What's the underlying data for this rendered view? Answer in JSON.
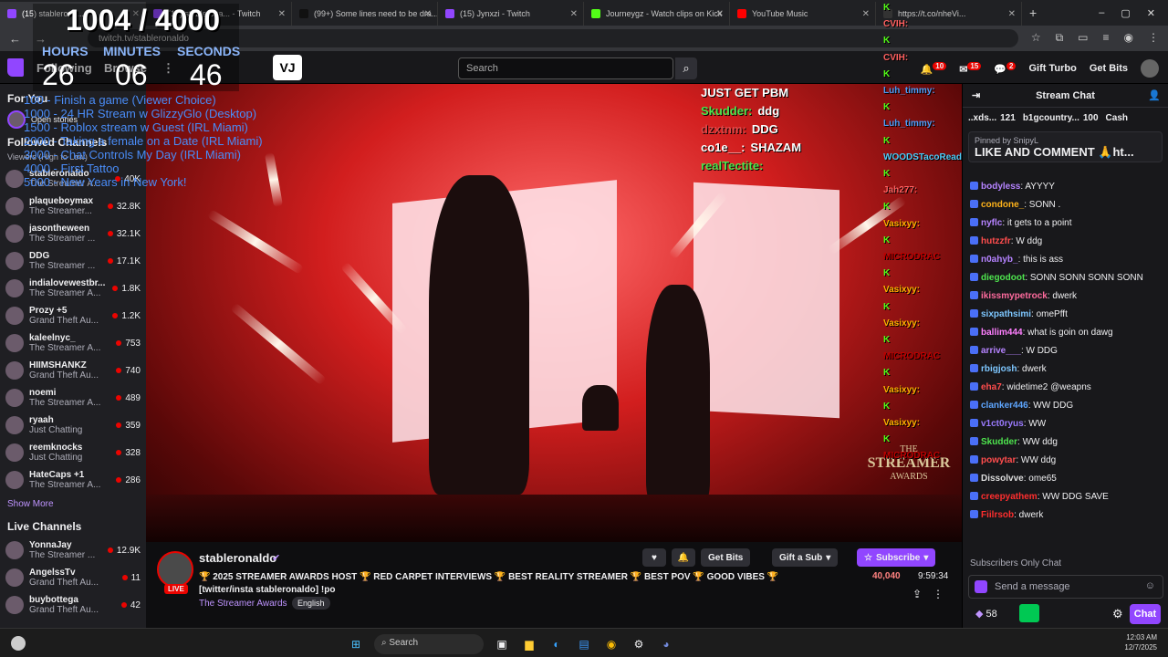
{
  "browser": {
    "tabs": [
      {
        "label": "(15) stablerona...",
        "color": "#9146ff",
        "active": true
      },
      {
        "label": "(15) stablerona... - Twitch",
        "color": "#9146ff"
      },
      {
        "label": "(99+) Some lines need to be dra...",
        "color": "#111111"
      },
      {
        "label": "(15) Jynxzi - Twitch",
        "color": "#9146ff"
      },
      {
        "label": "Journeygz - Watch clips on Kick",
        "color": "#53fc18"
      },
      {
        "label": "YouTube Music",
        "color": "#ff0000"
      },
      {
        "label": "https://t.co/nheVi...",
        "color": "#333333"
      }
    ],
    "url": "twitch.tv/stableronaldo",
    "win_controls": [
      "–",
      "▢",
      "✕"
    ]
  },
  "twitch_nav": {
    "following": "Following",
    "browse": "Browse",
    "search_placeholder": "Search",
    "gift_turbo": "Gift Turbo",
    "get_bits": "Get Bits",
    "notif_count": "10",
    "inbox_count": "15",
    "whisper_count": "2"
  },
  "overlay": {
    "counter": "1004 / 4000",
    "labels": {
      "hours": "HOURS",
      "minutes": "MINUTES",
      "seconds": "SECONDS"
    },
    "hours": "26",
    "minutes": "06",
    "seconds": "46",
    "goals": [
      "100 - Finish a game (Viewer Choice)",
      "1000 - 24 HR Stream w GlizzyGlo (Desktop)",
      "1500 - Roblox stream w Guest (IRL Miami)",
      "2000 - Taking a female on a Date (IRL Miami)",
      "3000 - Chat Controls My Day (IRL Miami)",
      "4000 - First Tattoo",
      "5000 - New Years in New York!"
    ],
    "pbm_title": "JUST GET PBM",
    "pbm": [
      {
        "user": "Skudder:",
        "msg": "ddg",
        "color": "#4ee44e"
      },
      {
        "user": "dzxtnm:",
        "msg": "DDG",
        "color": "#e04848"
      },
      {
        "user": "co1e__:",
        "msg": "SHAZAM",
        "color": "#ffffff"
      },
      {
        "user": "realTectite:",
        "msg": "",
        "color": "#4ee44e"
      }
    ],
    "kick_chat": [
      {
        "user": "CVIH:",
        "color": "#ff6060"
      },
      {
        "user": "CVIH:",
        "color": "#ff6060"
      },
      {
        "user": "Luh_timmy:",
        "color": "#4e9cf7"
      },
      {
        "user": "Luh_timmy:",
        "color": "#4e9cf7"
      },
      {
        "user": "WOODSTacoRead",
        "color": "#4ecaf7"
      },
      {
        "user": "Jah277:",
        "color": "#ff6060"
      },
      {
        "user": "Vasixyy:",
        "color": "#ffb000"
      },
      {
        "user": "MICRODRAC",
        "color": "#c00000"
      },
      {
        "user": "Vasixyy:",
        "color": "#ffb000"
      },
      {
        "user": "Vasixyy:",
        "color": "#ffb000"
      },
      {
        "user": "MICRODRAC",
        "color": "#c00000"
      },
      {
        "user": "Vasixyy:",
        "color": "#ffb000"
      },
      {
        "user": "Vasixyy:",
        "color": "#ffb000"
      },
      {
        "user": "MICRODRAC",
        "color": "#c00000"
      }
    ],
    "award_line1": "THE",
    "award_line2": "STREAMER",
    "award_line3": "AWARDS"
  },
  "sidebar": {
    "for_you": "For You",
    "open_stories": "Open stories",
    "followed": "Followed Channels",
    "sort": "Viewers (High to Low)",
    "channels": [
      {
        "name": "stableronaldo",
        "game": "The Streamer A...",
        "viewers": "40K"
      },
      {
        "name": "plaqueboymax",
        "game": "The Streamer...",
        "viewers": "32.8K"
      },
      {
        "name": "jasontheween",
        "game": "The Streamer ...",
        "viewers": "32.1K"
      },
      {
        "name": "DDG",
        "game": "The Streamer ...",
        "viewers": "17.1K"
      },
      {
        "name": "indialovewestbr...",
        "game": "The Streamer A...",
        "viewers": "1.8K"
      },
      {
        "name": "Prozy +5",
        "game": "Grand Theft Au...",
        "viewers": "1.2K"
      },
      {
        "name": "kaleelnyc_",
        "game": "The Streamer A...",
        "viewers": "753"
      },
      {
        "name": "HIIMSHANKZ",
        "game": "Grand Theft Au...",
        "viewers": "740"
      },
      {
        "name": "noemi",
        "game": "The Streamer A...",
        "viewers": "489"
      },
      {
        "name": "ryaah",
        "game": "Just Chatting",
        "viewers": "359"
      },
      {
        "name": "reemknocks",
        "game": "Just Chatting",
        "viewers": "328"
      },
      {
        "name": "HateCaps +1",
        "game": "The Streamer A...",
        "viewers": "286"
      }
    ],
    "show_more": "Show More",
    "live_channels": "Live Channels",
    "live": [
      {
        "name": "YonnaJay",
        "game": "The Streamer ...",
        "viewers": "12.9K"
      },
      {
        "name": "AngelssTv",
        "game": "Grand Theft Au...",
        "viewers": "11"
      },
      {
        "name": "buybottega",
        "game": "Grand Theft Au...",
        "viewers": "42"
      }
    ]
  },
  "stream_info": {
    "streamer": "stableronaldo",
    "live_badge": "LIVE",
    "title": "🏆 2025 STREAMER AWARDS HOST 🏆 RED CARPET INTERVIEWS 🏆 BEST REALITY STREAMER 🏆 BEST POV 🏆 GOOD VIBES 🏆 [twitter/insta stableronaldo] !po",
    "category": "The Streamer Awards",
    "language": "English",
    "viewers": "40,040",
    "uptime": "9:59:34",
    "get_bits": "Get Bits",
    "gift_sub": "Gift a Sub",
    "subscribe": "Subscribe"
  },
  "chat": {
    "header": "Stream Chat",
    "gifters": [
      {
        "name": "..xds...",
        "count": "121"
      },
      {
        "name": "b1gcountry...",
        "count": "100"
      },
      {
        "name": "Cash",
        "count": ""
      }
    ],
    "pinned_by": "Pinned by SnipyL",
    "pinned_msg": "LIKE AND COMMENT 🙏ht...",
    "messages": [
      {
        "user": "bodyless",
        "text": ": AYYYY",
        "color": "#b583ff"
      },
      {
        "user": "condone_",
        "text": ": SONN .",
        "color": "#ffb31a"
      },
      {
        "user": "nyflc",
        "text": ": it gets to a point",
        "color": "#b583ff"
      },
      {
        "user": "hutzzfr",
        "text": ": W ddg",
        "color": "#ff4d4d"
      },
      {
        "user": "n0ahyb_",
        "text": ": this is ass",
        "color": "#b583ff"
      },
      {
        "user": "diegodoot",
        "text": ": SONN SONN SONN SONN",
        "color": "#4ee44e"
      },
      {
        "user": "ikissmypetrock",
        "text": ": dwerk",
        "color": "#ff6b9e"
      },
      {
        "user": "sixpathsimi",
        "text": ": omePfft",
        "color": "#7ec7ff"
      },
      {
        "user": "ballim444",
        "text": ": what is goin on dawg",
        "color": "#ff7fff"
      },
      {
        "user": "arrive___",
        "text": ": W DDG",
        "color": "#b583ff"
      },
      {
        "user": "rbigjosh",
        "text": ": dwerk",
        "color": "#7ec7ff"
      },
      {
        "user": "eha7",
        "text": ": widetime2 @weapns",
        "color": "#ff4d4d"
      },
      {
        "user": "clanker446",
        "text": ": WW DDG",
        "color": "#5ea6ff"
      },
      {
        "user": "v1ct0ryus",
        "text": ": WW",
        "color": "#9b7bff"
      },
      {
        "user": "Skudder",
        "text": ": WW ddg",
        "color": "#4ee44e"
      },
      {
        "user": "powytar",
        "text": ": WW ddg",
        "color": "#ff4d4d"
      },
      {
        "user": "Dissolvve",
        "text": ": ome65",
        "color": "#dddddd"
      },
      {
        "user": "creepyathem",
        "text": ": WW DDG SAVE",
        "color": "#ff2e2e"
      },
      {
        "user": "Fiilrsob",
        "text": ": dwerk",
        "color": "#ff2e2e"
      }
    ],
    "subs_only": "Subscribers Only Chat",
    "placeholder": "Send a message",
    "points": "58",
    "chat_button": "Chat"
  },
  "taskbar": {
    "search": "Search",
    "time": "12:03 AM",
    "date": "12/7/2025"
  }
}
